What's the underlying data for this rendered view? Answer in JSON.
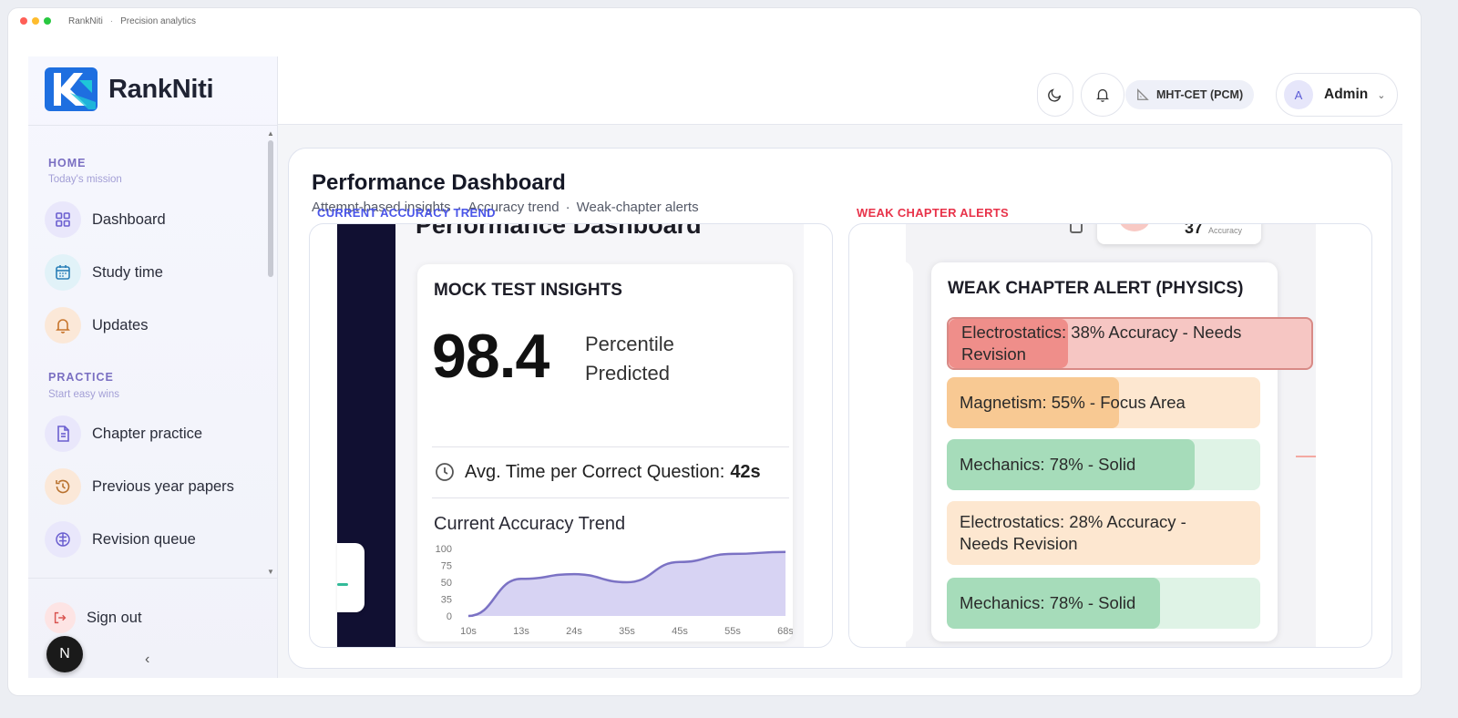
{
  "window": {
    "title": "RankNiti",
    "subtitle": "Precision analytics",
    "dots": [
      "#ff5f57",
      "#febc2e",
      "#28c840"
    ]
  },
  "brand": {
    "name": "RankNiti",
    "colors": {
      "primary": "#1e6fe0",
      "accent": "#1ec6d8"
    }
  },
  "sidebar": {
    "sections": [
      {
        "title": "HOME",
        "subtitle": "Today's mission",
        "items": [
          {
            "label": "Dashboard",
            "icon": "grid-icon"
          },
          {
            "label": "Study time",
            "icon": "calendar-icon"
          },
          {
            "label": "Updates",
            "icon": "bell-icon"
          }
        ]
      },
      {
        "title": "PRACTICE",
        "subtitle": "Start easy wins",
        "items": [
          {
            "label": "Chapter practice",
            "icon": "document-icon"
          },
          {
            "label": "Previous year papers",
            "icon": "history-icon"
          },
          {
            "label": "Revision queue",
            "icon": "brain-icon"
          }
        ]
      }
    ],
    "signout_label": "Sign out",
    "collapse_glyph": "‹",
    "badge_letter": "N"
  },
  "header": {
    "exam_label": "MHT-CET (PCM)",
    "user_initial": "A",
    "user_name": "Admin"
  },
  "main": {
    "title": "Performance Dashboard",
    "subtitle_parts": [
      "Attempt-based insights",
      "Accuracy trend",
      "Weak-chapter alerts"
    ],
    "left_panel_label": "CURRENT ACCURACY TREND",
    "right_panel_label": "WEAK CHAPTER ALERTS",
    "label_colors": {
      "left": "#4a55e8",
      "right": "#e8334a"
    }
  },
  "insights": {
    "ghost_title": "Performance Dashboard",
    "title": "MOCK TEST INSIGHTS",
    "percentile": "98.4",
    "percentile_label_1": "Percentile",
    "percentile_label_2": "Predicted",
    "avg_time_label": "Avg. Time per Correct Question:",
    "avg_time_value": "42s",
    "trend_title": "Current Accuracy Trend"
  },
  "chart_data": {
    "type": "area",
    "x": [
      "10s",
      "13s",
      "24s",
      "35s",
      "45s",
      "55s",
      "68s"
    ],
    "yticks": [
      100,
      75,
      50,
      35,
      0
    ],
    "ylim": [
      0,
      100
    ],
    "values": [
      0,
      55,
      62,
      50,
      80,
      92,
      95
    ],
    "color": "#7b72c4"
  },
  "alerts": {
    "title": "WEAK CHAPTER ALERT (PHYSICS)",
    "top_value": "37",
    "top_unit": "Accuracy",
    "items": [
      {
        "text": "Electrostatics: 38% Accuracy - Needs Revision",
        "level": "red",
        "fill": 0.33
      },
      {
        "text": "Magnetism: 55% - Focus Area",
        "level": "orange",
        "fill": 0.55
      },
      {
        "text": "Mechanics: 78% - Solid",
        "level": "green",
        "fill": 0.79
      },
      {
        "text": "Electrostatics: 28% Accuracy - Needs Revision",
        "level": "orange",
        "fill": 0.0
      },
      {
        "text": "Mechanics: 78% - Solid",
        "level": "green",
        "fill": 0.68
      }
    ]
  }
}
